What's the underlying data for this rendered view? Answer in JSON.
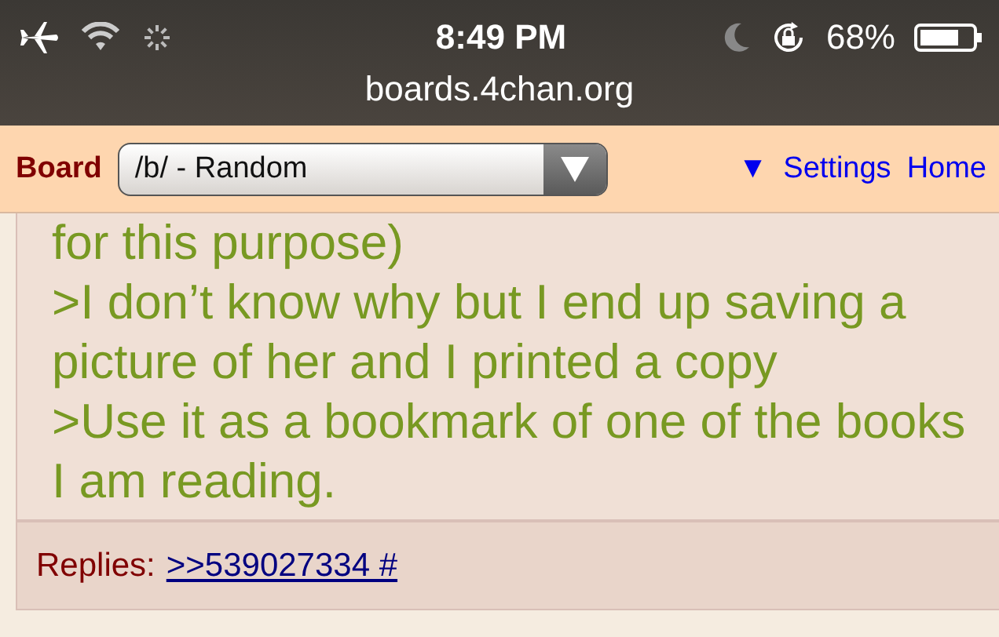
{
  "status_bar": {
    "time": "8:49 PM",
    "battery": "68%"
  },
  "address_bar": {
    "url": "boards.4chan.org"
  },
  "board_bar": {
    "label": "Board",
    "select": {
      "value": "/b/ - Random"
    },
    "toggle": "▼",
    "links": [
      "Settings",
      "Home"
    ]
  },
  "post": {
    "lines": [
      {
        "kind": "greentext",
        "text": "for this purpose)"
      },
      {
        "kind": "greentext",
        "text": ">I don’t know why but I end up saving a picture of her and I printed a copy"
      },
      {
        "kind": "greentext",
        "text": ">Use it as a bookmark of one of the books I am reading."
      }
    ],
    "replies": {
      "label": "Replies:",
      "link": ">>539027334 #"
    }
  }
}
